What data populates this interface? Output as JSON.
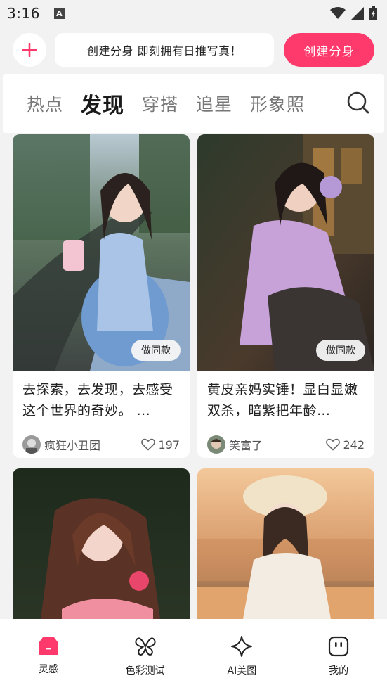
{
  "status_bar": {
    "time": "3:16"
  },
  "create_bar": {
    "promo_text": "创建分身 即刻拥有日推写真！",
    "create_button": "创建分身"
  },
  "tabs": [
    {
      "label": "热点",
      "active": false
    },
    {
      "label": "发现",
      "active": true
    },
    {
      "label": "穿搭",
      "active": false
    },
    {
      "label": "追星",
      "active": false
    },
    {
      "label": "形象照",
      "active": false
    }
  ],
  "feed": [
    {
      "same_button": "做同款",
      "title": "去探索，去发现，去感受这个世界的奇妙。 ...",
      "author": "疯狂小丑团",
      "likes": "197"
    },
    {
      "same_button": "做同款",
      "title": "黄皮亲妈实锤！显白显嫩双杀，暗紫把年龄…",
      "author": "笑富了",
      "likes": "242"
    }
  ],
  "bottom_nav": [
    {
      "label": "灵感",
      "icon": "inspiration-icon",
      "active": true
    },
    {
      "label": "色彩测试",
      "icon": "butterfly-icon",
      "active": false
    },
    {
      "label": "AI美图",
      "icon": "sparkle-icon",
      "active": false
    },
    {
      "label": "我的",
      "icon": "profile-icon",
      "active": false
    }
  ],
  "colors": {
    "accent": "#fd3a6b",
    "background": "#f2f2f2"
  }
}
